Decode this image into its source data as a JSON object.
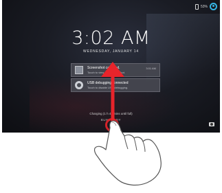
{
  "status_bar": {
    "battery": "53%"
  },
  "lockscreen": {
    "time": "3:02 AM",
    "date": "WEDNESDAY, JANUARY 14",
    "charging": "Charging (1 h 44 mins until full)",
    "owner": "ELNOBODY"
  },
  "notifications": [
    {
      "title": "Screenshot captured.",
      "subtitle": "Touch to view your screenshot.",
      "time": "3:01 AM",
      "icon": "screenshot-thumbnail-icon"
    },
    {
      "title": "USB debugging connected",
      "subtitle": "Touch to disable USB debugging.",
      "time": "",
      "icon": "usb-debug-icon"
    }
  ],
  "overlay": {
    "arrow_color": "#e8242b",
    "ring_color": "#d2232a",
    "gesture": "swipe-up"
  },
  "colors": {
    "accent": "#35b5e5"
  }
}
